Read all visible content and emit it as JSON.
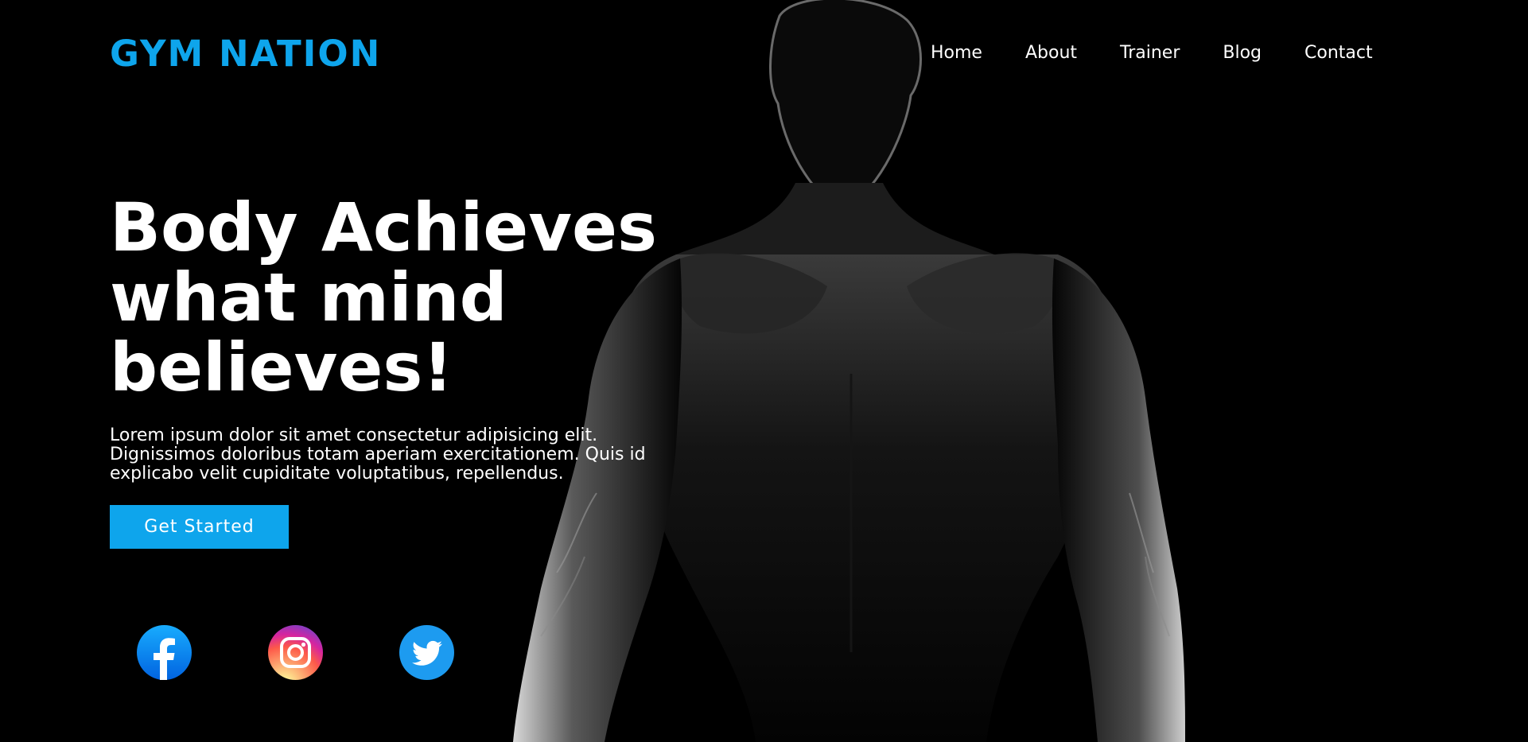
{
  "brand": {
    "name": "GYM NATION",
    "accent_color": "#0ea5ec"
  },
  "nav": {
    "items": [
      {
        "label": "Home"
      },
      {
        "label": "About"
      },
      {
        "label": "Trainer"
      },
      {
        "label": "Blog"
      },
      {
        "label": "Contact"
      }
    ]
  },
  "hero": {
    "headline_line1": "Body Achieves",
    "headline_line2": "what mind",
    "headline_line3": "believes!",
    "lead_line1": "Lorem ipsum dolor sit amet consectetur adipisicing elit.",
    "lead_line2": "Dignissimos doloribus totam aperiam exercitationem. Quis id",
    "lead_line3": "explicabo velit cupiditate voluptatibus, repellendus.",
    "cta_label": "Get Started",
    "background_image": "muscular-man-silhouette"
  },
  "social": {
    "items": [
      {
        "icon": "facebook-icon",
        "color": "#1877f2"
      },
      {
        "icon": "instagram-icon",
        "color": "#e1306c"
      },
      {
        "icon": "twitter-icon",
        "color": "#1da1f2"
      }
    ]
  }
}
